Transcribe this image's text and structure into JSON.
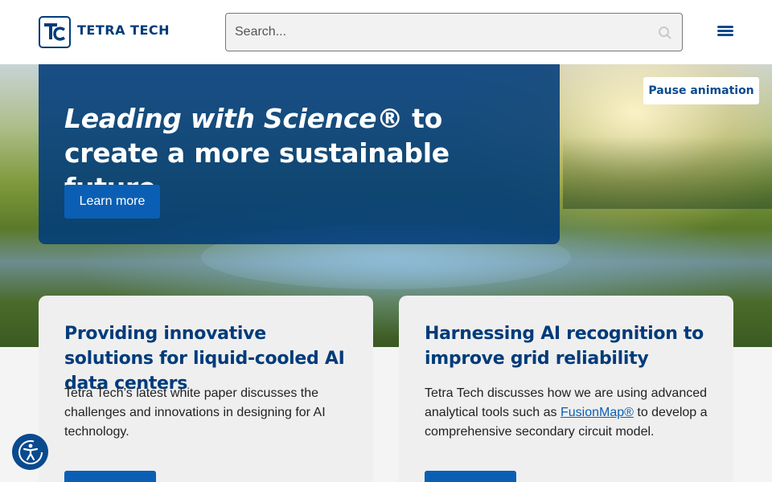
{
  "header": {
    "logo_text": "TETRA TECH",
    "search": {
      "placeholder": "Search...",
      "value": ""
    },
    "menu_icon": "hamburger-menu-icon"
  },
  "hero": {
    "title_em": "Leading with Science®",
    "title_rest": " to create a more sustainable future",
    "cta_label": "Learn more",
    "pause_label": "Pause animation"
  },
  "cards": [
    {
      "title": "Providing innovative solutions for liquid-cooled AI data centers",
      "text": "Tetra Tech’s latest white paper discusses the challenges and innovations in designing for AI technology.",
      "button_label": ""
    },
    {
      "title": "Harnessing AI recognition to improve grid reliability",
      "text_before": "Tetra Tech discusses how we are using advanced analytical tools such as ",
      "link": "FusionMap®",
      "text_after": " to develop a comprehensive secondary circuit model.",
      "button_label": ""
    }
  ],
  "accessibility": {
    "icon": "accessibility-person-icon"
  },
  "colors": {
    "brand_navy": "#003b7a",
    "accent_blue": "#0a5fb4"
  }
}
